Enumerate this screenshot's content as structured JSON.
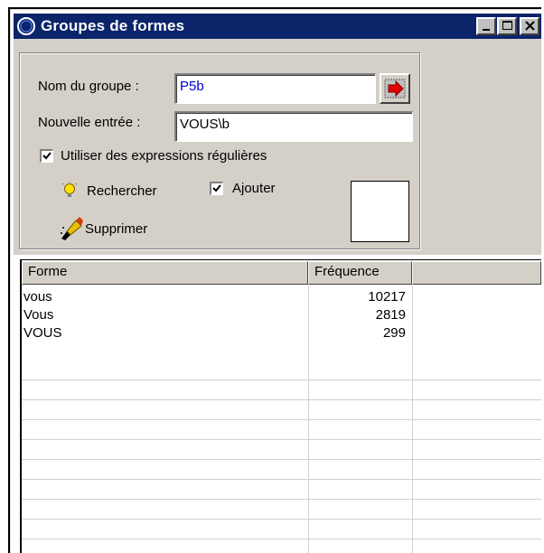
{
  "window": {
    "title": "Groupes de formes",
    "controls": [
      "minimize",
      "maximize",
      "close"
    ]
  },
  "form": {
    "group_name_label": "Nom du groupe :",
    "group_name_value": "P5b",
    "new_entry_label": "Nouvelle entrée :",
    "new_entry_value": "VOUS\\b",
    "use_regex_label": "Utiliser des expressions régulières",
    "use_regex_checked": true,
    "search_label": "Rechercher",
    "add_label": "Ajouter",
    "add_checked": true,
    "delete_label": "Supprimer"
  },
  "table": {
    "columns": [
      "Forme",
      "Fréquence"
    ],
    "rows": [
      {
        "forme": "vous",
        "frequence": "10217"
      },
      {
        "forme": "Vous",
        "frequence": "2819"
      },
      {
        "forme": "VOUS",
        "frequence": "299"
      }
    ]
  },
  "colors": {
    "titlebar": "#0b246a",
    "panel": "#d4d0c8",
    "field_text_blue": "#0000cc"
  }
}
